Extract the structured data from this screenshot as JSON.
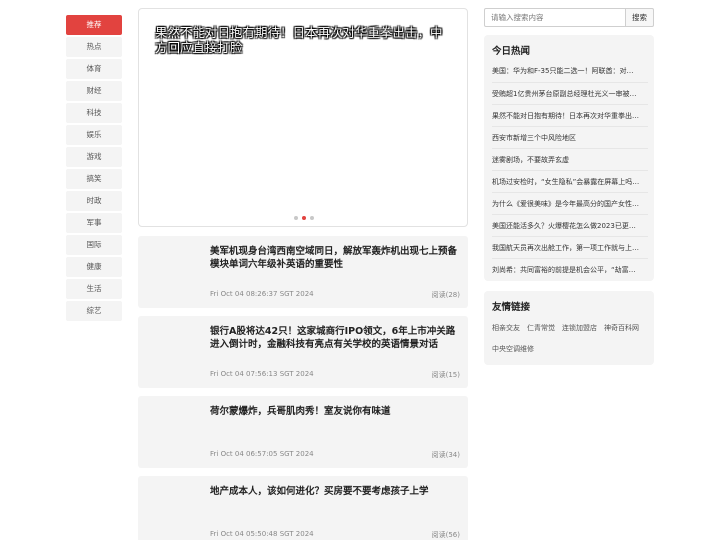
{
  "nav": {
    "items": [
      "推荐",
      "热点",
      "体育",
      "财经",
      "科技",
      "娱乐",
      "游戏",
      "搞笑",
      "时政",
      "军事",
      "国际",
      "健康",
      "生活",
      "综艺"
    ],
    "active_index": 0
  },
  "carousel": {
    "caption": "果然不能对日抱有期待！日本再次对华重拳出击，中方回应直接打脸",
    "slide_count": 3,
    "active_slide": 1
  },
  "articles": [
    {
      "title": "美军机现身台湾西南空域同日，解放军轰炸机出现七上预备模块单词六年级补英语的重要性",
      "date": "Fri Oct 04 08:26:37 SGT 2024",
      "reads": "阅读(28)"
    },
    {
      "title": "银行A股将达42只！这家城商行IPO领文，6年上市冲关路进入倒计时，金融科技有亮点有关学校的英语情景对话",
      "date": "Fri Oct 04 07:56:13 SGT 2024",
      "reads": "阅读(15)"
    },
    {
      "title": "荷尔蒙爆炸，兵哥肌肉秀！室友说你有味道",
      "date": "Fri Oct 04 06:57:05 SGT 2024",
      "reads": "阅读(34)"
    },
    {
      "title": "地产成本人，该如何进化？买房要不要考虑孩子上学",
      "date": "Fri Oct 04 05:50:48 SGT 2024",
      "reads": "阅读(56)"
    }
  ],
  "search": {
    "placeholder": "请输入搜索内容",
    "button_label": "搜索"
  },
  "hot": {
    "title": "今日热闻",
    "items": [
      "美国：华为和F-35只能二选一！阿联酋：对…",
      "受贿超1亿贵州茅台原副总经理杜光义一审被…",
      "果然不能对日抱有期待！日本再次对华重拳出…",
      "西安市新增三个中风险地区",
      "迷雾剧场，不要故弄玄虚",
      "机场过安检时，“女生隐私”会暴露在屏幕上吗…",
      "为什么《爱很美味》是今年最高分的国产女性…",
      "美国还能活多久？火爆樱花怎么做2023已更…",
      "我国航天员再次出舱工作，第一项工作就与上…",
      "刘尚希：共同富裕的前提是机会公平，“劫富…"
    ]
  },
  "links": {
    "title": "友情链接",
    "items": [
      "相亲交友",
      "仁青常觉",
      "连锁加盟店",
      "神奇百科网",
      "中央空调维修"
    ]
  }
}
